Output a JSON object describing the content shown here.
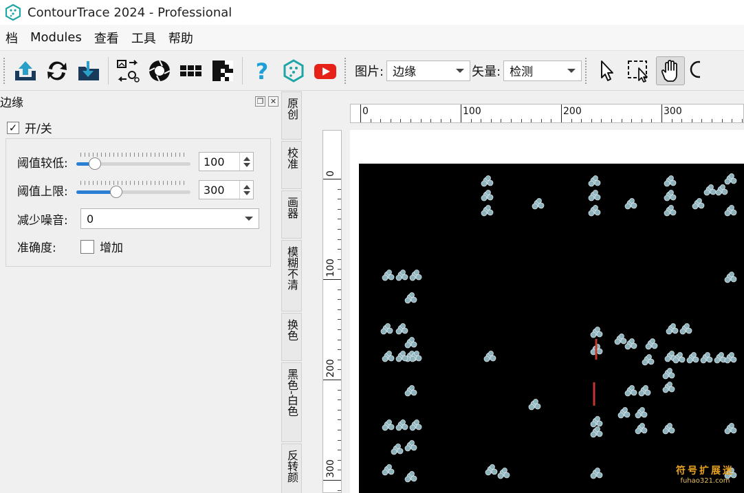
{
  "app": {
    "title": "ContourTrace 2024 - Professional",
    "accent": "#1fa5a5"
  },
  "menu": {
    "items": [
      {
        "label": "档"
      },
      {
        "label": "Modules"
      },
      {
        "label": "查看"
      },
      {
        "label": "工具"
      },
      {
        "label": "帮助"
      }
    ]
  },
  "toolbar": {
    "buttons": [
      {
        "icon": "upload-icon"
      },
      {
        "icon": "refresh-icon"
      },
      {
        "icon": "download-icon"
      },
      {
        "icon": "trace-settings-icon"
      },
      {
        "icon": "aperture-icon"
      },
      {
        "icon": "grid-icon"
      },
      {
        "icon": "pixel-pattern-icon"
      },
      {
        "icon": "help-icon"
      },
      {
        "icon": "app-logo-icon"
      },
      {
        "icon": "youtube-icon"
      }
    ],
    "image_label": "图片:",
    "image_value": "边缘",
    "vector_label": "矢量:",
    "vector_value": "检测",
    "tools": [
      "pointer-icon",
      "selection-icon",
      "hand-icon"
    ]
  },
  "panel": {
    "title": "边缘",
    "toggle_checked": true,
    "toggle_label": "开/关",
    "threshold_low_label": "阈值较低:",
    "threshold_low_value": "100",
    "threshold_low_level": 0.12,
    "threshold_high_label": "阈值上限:",
    "threshold_high_value": "300",
    "threshold_high_level": 0.33,
    "noise_label": "减少噪音:",
    "noise_value": "0",
    "accuracy_label": "准确度:",
    "accuracy_option": "增加",
    "accuracy_checked": false
  },
  "tabs": [
    {
      "label": "原创"
    },
    {
      "label": "校准"
    },
    {
      "label": "画器"
    },
    {
      "label": "模糊不清"
    },
    {
      "label": "换色"
    },
    {
      "label": "黑色-白色"
    },
    {
      "label": "反转颜"
    }
  ],
  "ruler": {
    "h_labels": [
      "0",
      "100",
      "200",
      "300"
    ],
    "v_labels": [
      "0",
      "100",
      "200",
      "300"
    ]
  },
  "watermark": {
    "main": "符号扩展迷",
    "sub": "fuhao321.com"
  }
}
